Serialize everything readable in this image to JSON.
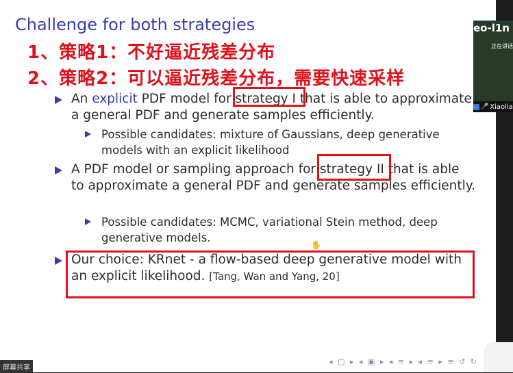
{
  "slide": {
    "title": "Challenge for both strategies",
    "note_1": "1、策略1：不好逼近残差分布",
    "note_2": "2、策略2：可以逼近残差分布，需要快速采样",
    "bullet1": {
      "pre": "An ",
      "em": "explicit",
      "mid": " PDF model for ",
      "strategy": "strategy I",
      "post": " that is able to approximate a general PDF and generate samples efficiently."
    },
    "bullet1_sub": "Possible candidates: mixture of Gaussians, deep generative models with an explicit likelihood",
    "bullet2": {
      "pre": "A PDF model or sampling approach for ",
      "strategy": "strategy II",
      "post": " that is able to approximate a general PDF and generate samples efficiently."
    },
    "bullet2_sub": "Possible candidates: MCMC, variational Stein method, deep generative models.",
    "bullet3": {
      "text": "Our choice: KRnet - a flow-based deep generative model with an explicit likelihood.",
      "cite": "[Tang, Wan and Yang, 20]"
    },
    "nav_symbols": "◂ ▢ ▸ ◂ ▣ ▸ ◂ ≡ ▸ ◂ ≡ ▸   ≡   ↺ ↻"
  },
  "video": {
    "name_top": "eo-l1n",
    "tag": "正在讲话",
    "footer_name": "Xiaolia"
  },
  "share_label": "屏幕共享",
  "colors": {
    "accent_blue": "#3b3bb0",
    "annotation_red": "#e0101a"
  }
}
